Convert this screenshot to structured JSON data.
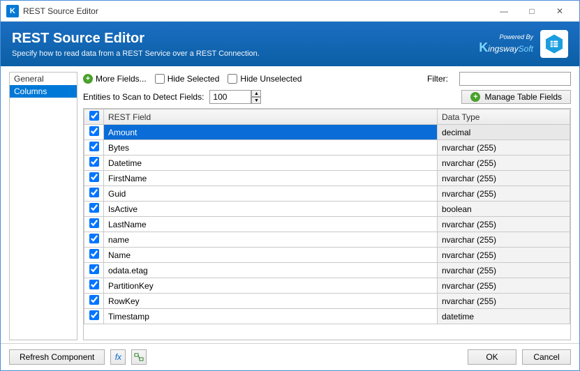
{
  "window": {
    "title": "REST Source Editor"
  },
  "header": {
    "title": "REST Source Editor",
    "subtitle": "Specify how to read data from a REST Service over a REST Connection.",
    "powered_by": "Powered By",
    "logo_text": "KingswaySoft"
  },
  "sidebar": {
    "items": [
      {
        "label": "General",
        "selected": false
      },
      {
        "label": "Columns",
        "selected": true
      }
    ]
  },
  "toolbar": {
    "more_fields": "More Fields...",
    "hide_selected": "Hide Selected",
    "hide_unselected": "Hide Unselected",
    "filter_label": "Filter:",
    "filter_value": "",
    "entities_label": "Entities to Scan to Detect Fields:",
    "entities_value": "100",
    "manage_table_fields": "Manage Table Fields"
  },
  "grid": {
    "col_check": "",
    "col_field": "REST Field",
    "col_type": "Data Type",
    "rows": [
      {
        "checked": true,
        "field": "Amount",
        "type": "decimal",
        "selected": true
      },
      {
        "checked": true,
        "field": "Bytes",
        "type": "nvarchar (255)",
        "selected": false
      },
      {
        "checked": true,
        "field": "Datetime",
        "type": "nvarchar (255)",
        "selected": false
      },
      {
        "checked": true,
        "field": "FirstName",
        "type": "nvarchar (255)",
        "selected": false
      },
      {
        "checked": true,
        "field": "Guid",
        "type": "nvarchar (255)",
        "selected": false
      },
      {
        "checked": true,
        "field": "IsActive",
        "type": "boolean",
        "selected": false
      },
      {
        "checked": true,
        "field": "LastName",
        "type": "nvarchar (255)",
        "selected": false
      },
      {
        "checked": true,
        "field": "name",
        "type": "nvarchar (255)",
        "selected": false
      },
      {
        "checked": true,
        "field": "Name",
        "type": "nvarchar (255)",
        "selected": false
      },
      {
        "checked": true,
        "field": "odata.etag",
        "type": "nvarchar (255)",
        "selected": false
      },
      {
        "checked": true,
        "field": "PartitionKey",
        "type": "nvarchar (255)",
        "selected": false
      },
      {
        "checked": true,
        "field": "RowKey",
        "type": "nvarchar (255)",
        "selected": false
      },
      {
        "checked": true,
        "field": "Timestamp",
        "type": "datetime",
        "selected": false
      }
    ]
  },
  "footer": {
    "refresh": "Refresh Component",
    "ok": "OK",
    "cancel": "Cancel"
  }
}
